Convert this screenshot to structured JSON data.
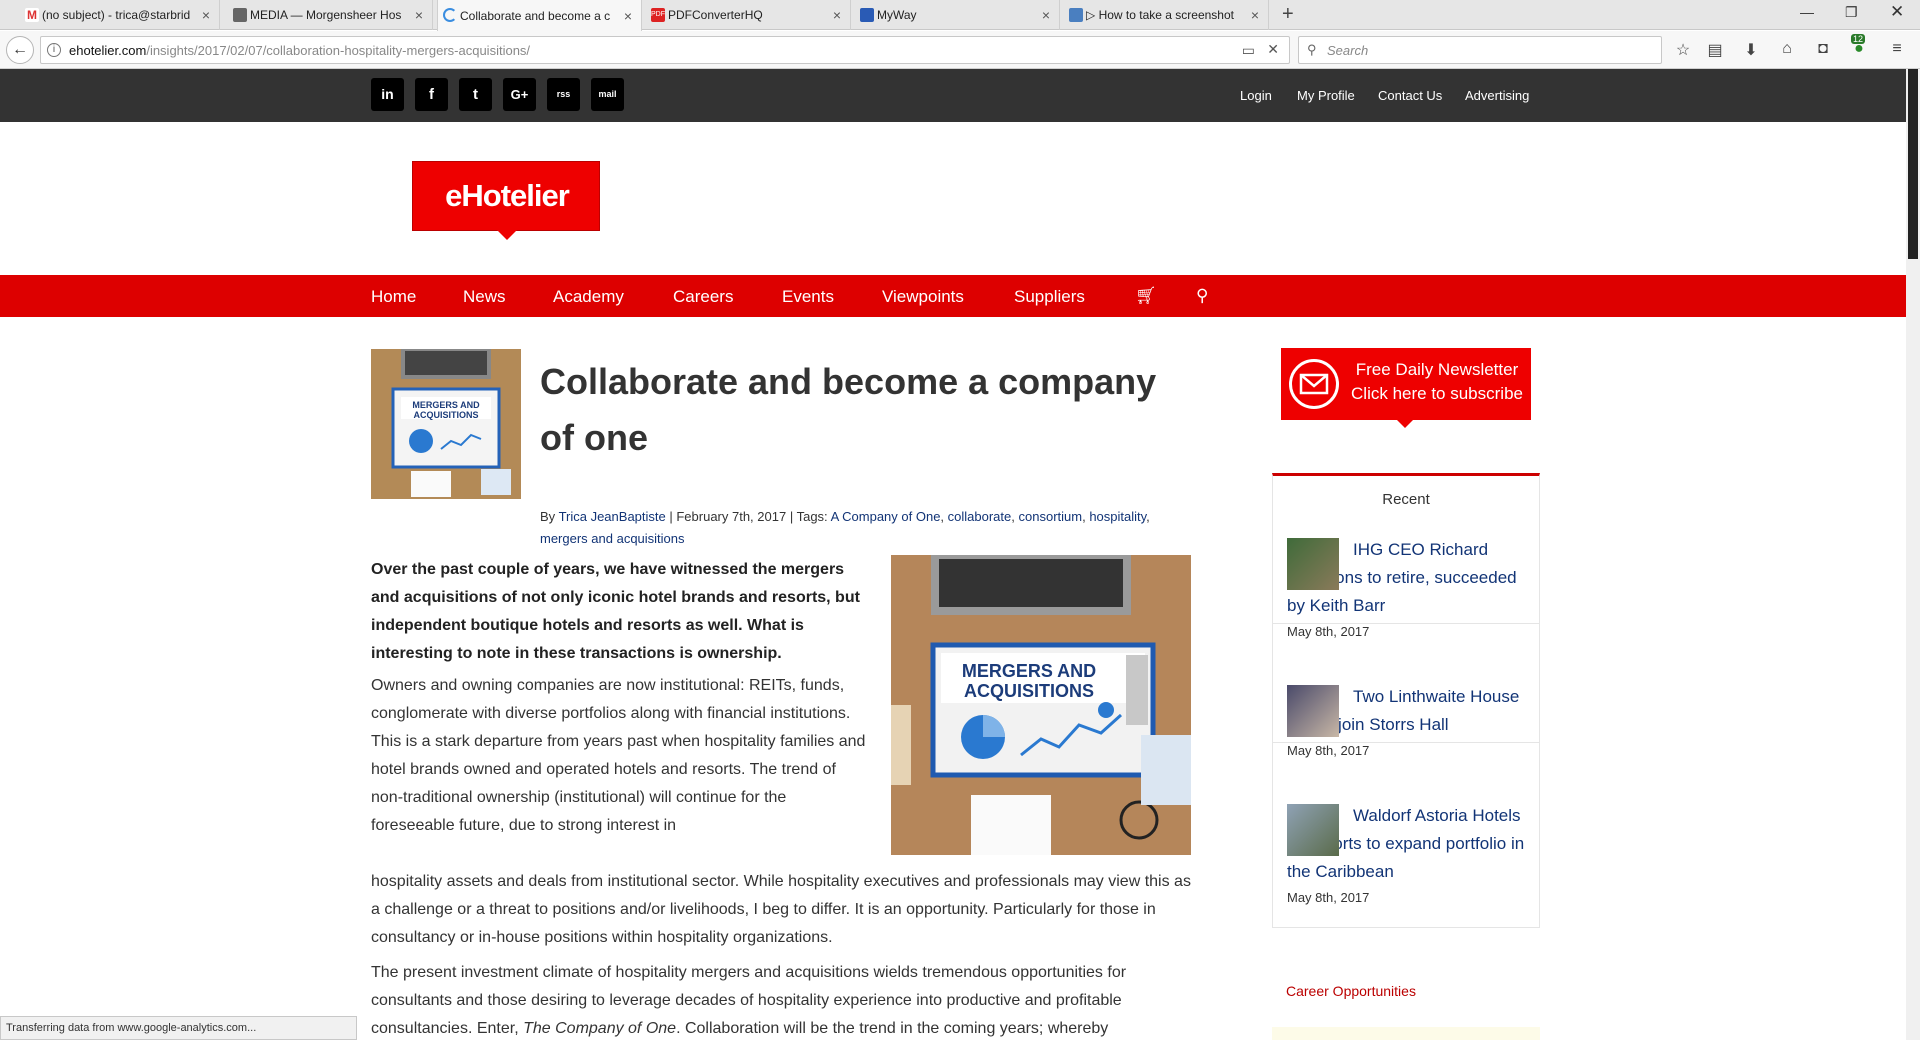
{
  "browser": {
    "tabs": [
      {
        "label": "(no subject) - trica@starbrid",
        "icon": "gmail-icon"
      },
      {
        "label": "MEDIA — Morgensheer Hos",
        "icon": "box-icon"
      },
      {
        "label": "Collaborate and become a c",
        "icon": "loading-icon"
      },
      {
        "label": "PDFConverterHQ",
        "icon": "pdf-icon"
      },
      {
        "label": "MyWay",
        "icon": "myway-icon"
      },
      {
        "label": "▷ How to take a screenshot",
        "icon": "screenshot-icon"
      }
    ],
    "url_host": "ehotelier.com",
    "url_path": "/insights/2017/02/07/collaboration-hospitality-mergers-acquisitions/",
    "search_placeholder": "Search",
    "badge_count": "12",
    "status_text": "Transferring data from www.google-analytics.com..."
  },
  "topbar": {
    "social": [
      "in",
      "f",
      "t",
      "G+",
      "rss",
      "mail"
    ],
    "links": [
      "Login",
      "My Profile",
      "Contact Us",
      "Advertising"
    ]
  },
  "logo": {
    "text": "eHotelier"
  },
  "nav": {
    "items": [
      "Home",
      "News",
      "Academy",
      "Careers",
      "Events",
      "Viewpoints",
      "Suppliers"
    ]
  },
  "article": {
    "title": "Collaborate and become a company of one",
    "by_prefix": "By",
    "author": "Trica JeanBaptiste",
    "date": "February 7th, 2017",
    "tags_prefix": "Tags:",
    "tags": [
      "A Company of One",
      "collaborate",
      "consortium",
      "hospitality",
      "mergers and acquisitions"
    ],
    "image_text_1": "MERGERS AND",
    "image_text_2": "ACQUISITIONS",
    "lead": "Over the past couple of years, we have witnessed the mergers and acquisitions of not only iconic hotel brands and resorts, but independent boutique hotels and resorts as well. What is interesting to note in these transactions is ownership.",
    "para1": "Owners and owning companies are now institutional: REITs, funds, conglomerate with diverse portfolios along with financial institutions. This is a stark departure from years past when hospitality families and hotel brands owned and operated hotels and resorts. The trend of non-traditional ownership (institutional) will continue for the foreseeable future, due to strong interest in",
    "para1b": "hospitality assets and deals from institutional sector. While hospitality executives and professionals may view this as a challenge or a threat to positions and/or livelihoods, I beg to differ. It is an opportunity. Particularly for those in consultancy or in-house positions within hospitality organizations.",
    "para2_a": "The present investment climate of hospitality mergers and acquisitions wields tremendous opportunities for consultants and those desiring to leverage decades of hospitality experience into productive and profitable consultancies. Enter, ",
    "para2_em": "The Company of One",
    "para2_b": ". Collaboration will be the trend in the coming years; whereby"
  },
  "sidebar": {
    "newsletter_line1": "Free Daily Newsletter",
    "newsletter_line2": "Click here to subscribe",
    "recent_title": "Recent",
    "recent": [
      {
        "title": "IHG CEO Richard Solomons to retire, succeeded by Keith Barr",
        "date": "May 8th, 2017"
      },
      {
        "title": "Two Linthwaite House heads join Storrs Hall",
        "date": "May 8th, 2017"
      },
      {
        "title": "Waldorf Astoria Hotels & Resorts to expand portfolio in the Caribbean",
        "date": "May 8th, 2017"
      }
    ],
    "career_title": "Career Opportunities"
  }
}
